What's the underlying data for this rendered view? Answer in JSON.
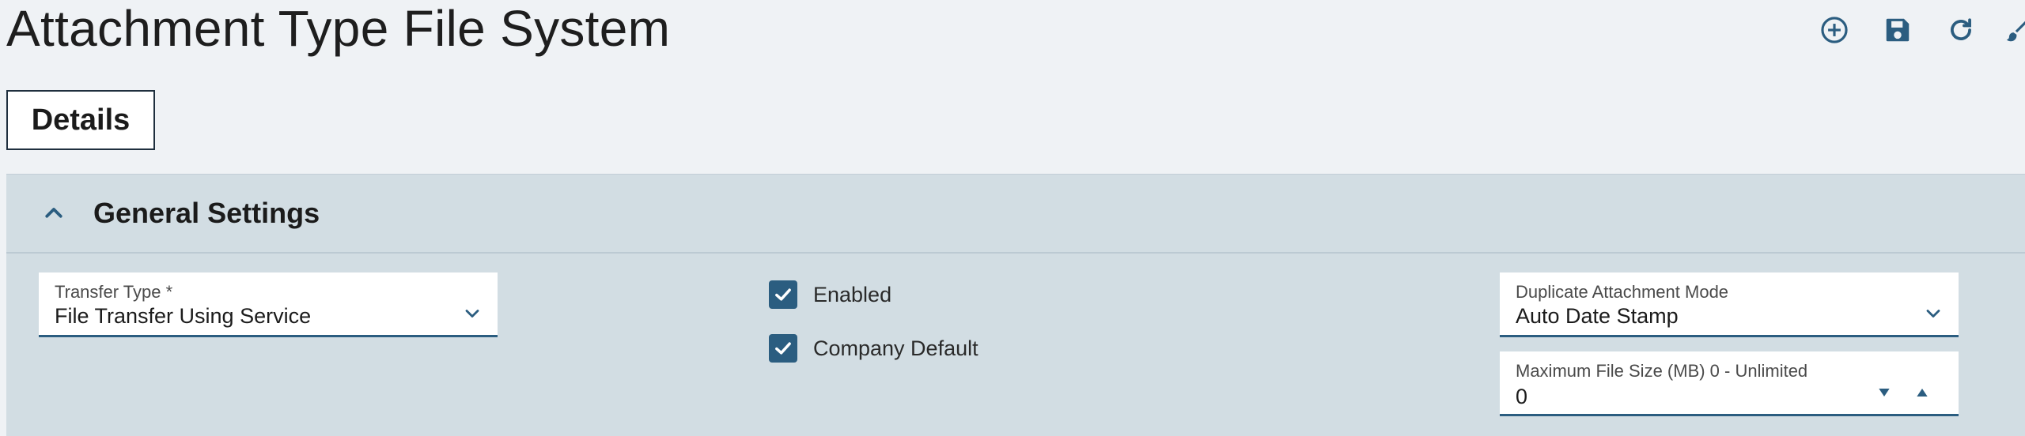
{
  "page": {
    "title": "Attachment Type File System"
  },
  "toolbar": {
    "buttons": [
      {
        "name": "add",
        "icon": "plus-circle-icon"
      },
      {
        "name": "save",
        "icon": "save-icon"
      },
      {
        "name": "refresh",
        "icon": "refresh-icon"
      },
      {
        "name": "more",
        "icon": "brush-icon"
      }
    ]
  },
  "tabs": [
    {
      "label": "Details",
      "active": true
    }
  ],
  "section": {
    "title": "General Settings",
    "expanded": true
  },
  "fields": {
    "transfer_type": {
      "label": "Transfer Type *",
      "value": "File Transfer Using Service"
    },
    "duplicate_mode": {
      "label": "Duplicate Attachment Mode",
      "value": "Auto Date Stamp"
    },
    "max_file_size": {
      "label": "Maximum File Size (MB) 0 - Unlimited",
      "value": "0"
    }
  },
  "checkboxes": {
    "enabled": {
      "label": "Enabled",
      "checked": true
    },
    "company_default": {
      "label": "Company Default",
      "checked": true
    }
  },
  "colors": {
    "accent": "#2b5d80",
    "page_bg": "#eff2f5",
    "section_bg": "#d2dde3"
  }
}
